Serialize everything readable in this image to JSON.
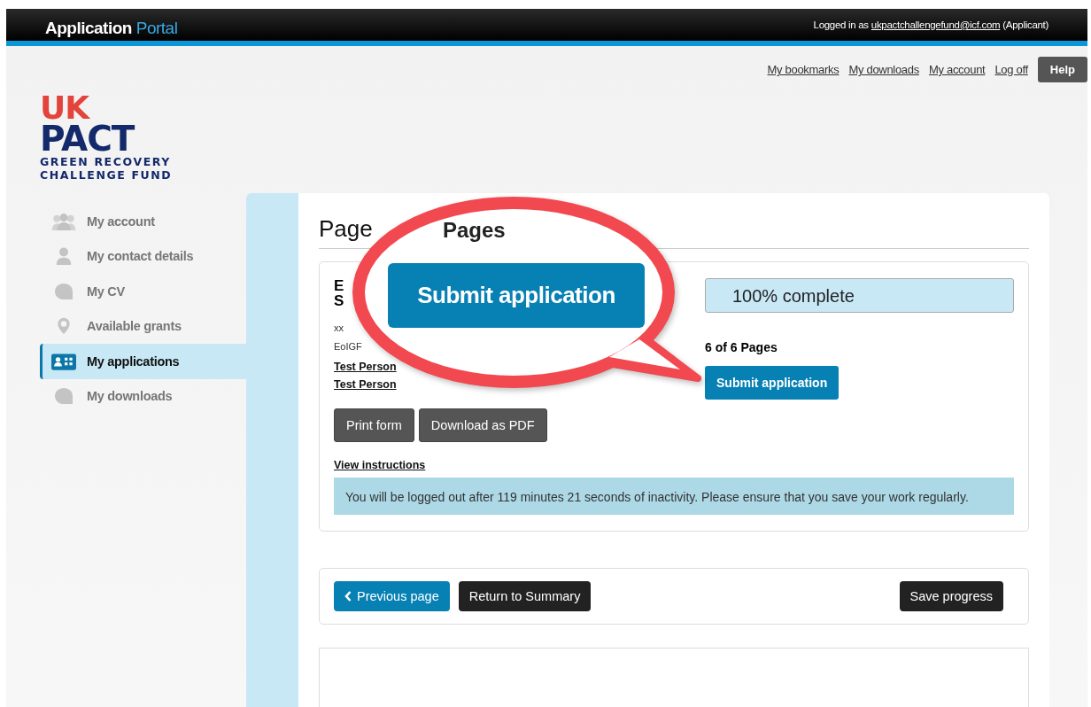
{
  "header": {
    "brand_bold": "Application",
    "brand_light": "Portal",
    "login_prefix": "Logged in as",
    "login_email": "ukpactchallengefund@icf.com",
    "login_role": "(Applicant)"
  },
  "top_links": [
    "My bookmarks",
    "My downloads",
    "My account",
    "Log off"
  ],
  "help_button": "Help",
  "logo": {
    "mark": "UK",
    "name": "PACT",
    "line1": "GREEN RECOVERY",
    "line2": "CHALLENGE FUND"
  },
  "sidebar": {
    "items": [
      {
        "label": "My account",
        "selected": false
      },
      {
        "label": "My contact details",
        "selected": false
      },
      {
        "label": "My CV",
        "selected": false
      },
      {
        "label": "Available grants",
        "selected": false
      },
      {
        "label": "My applications",
        "selected": true
      },
      {
        "label": "My downloads",
        "selected": false
      }
    ]
  },
  "main": {
    "heading": "Page",
    "heading_tail": "Pages",
    "summary": {
      "title_lines": [
        "E",
        "S"
      ],
      "meta": [
        "xx",
        "EoIGF"
      ],
      "people": [
        "Test Person",
        "Test Person"
      ],
      "progress": {
        "label": "100% complete",
        "level": 1
      },
      "page_count": "6 of 6 Pages",
      "submit_button": "Submit application"
    },
    "actions": [
      "Print form",
      "Download as PDF"
    ],
    "instructions_link": "View instructions",
    "alert": "You will be logged out after 119 minutes 21 seconds of inactivity. Please ensure that you save your work regularly.",
    "nav": {
      "previous": "Previous page",
      "return": "Return to Summary",
      "save": "Save progress"
    }
  },
  "callout": {
    "button": "Submit application"
  }
}
